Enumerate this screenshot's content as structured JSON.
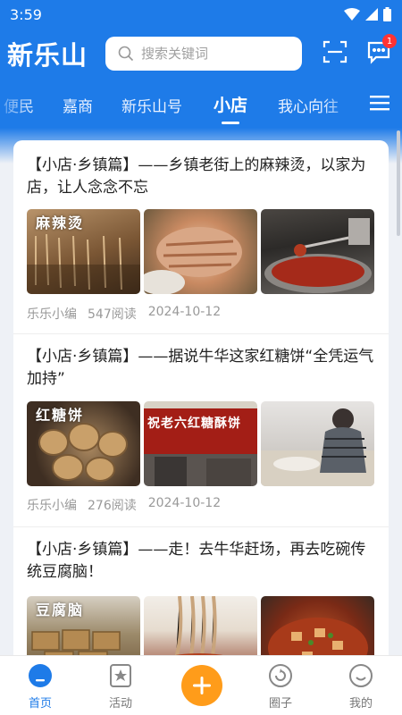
{
  "status": {
    "time": "3:59"
  },
  "header": {
    "logo": "新乐山",
    "search_placeholder": "搜索关键词",
    "message_badge": "1"
  },
  "tabs": [
    {
      "label": "便民"
    },
    {
      "label": "嘉商"
    },
    {
      "label": "新乐山号"
    },
    {
      "label": "小店",
      "active": true
    },
    {
      "label": "我心向往"
    }
  ],
  "articles": [
    {
      "title": "【小店·乡镇篇】——乡镇老街上的麻辣烫，以家为店，让人念念不忘",
      "author": "乐乐小编",
      "reads": "547阅读",
      "date": "2024-10-12",
      "thumb_caption": "麻辣烫"
    },
    {
      "title": "【小店·乡镇篇】——据说牛华这家红糖饼“全凭运气加持”",
      "author": "乐乐小编",
      "reads": "276阅读",
      "date": "2024-10-12",
      "thumb_caption": "红糖饼",
      "sign_text": "祝老六红糖酥饼"
    },
    {
      "title": "【小店·乡镇篇】——走！去牛华赶场，再去吃碗传统豆腐脑！",
      "thumb_caption": "豆腐脑"
    }
  ],
  "bottom_nav": [
    {
      "label": "首页",
      "icon": "home-icon",
      "active": true
    },
    {
      "label": "活动",
      "icon": "activity-icon"
    },
    {
      "label": "",
      "icon": "plus-icon"
    },
    {
      "label": "圈子",
      "icon": "circle-icon"
    },
    {
      "label": "我的",
      "icon": "profile-icon"
    }
  ],
  "colors": {
    "brand": "#1e7be8",
    "accent": "#ff9c1a",
    "badge": "#ff3333"
  }
}
